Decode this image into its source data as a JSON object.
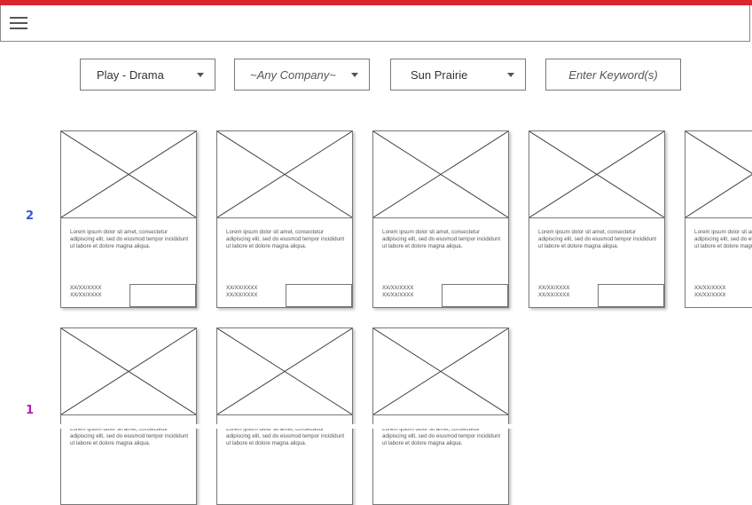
{
  "header": {
    "menu_icon": "hamburger-icon"
  },
  "filters": {
    "genre": "Play - Drama",
    "company": "~Any Company~",
    "location": "Sun Prairie",
    "keyword_placeholder": "Enter Keyword(s)"
  },
  "rows": [
    {
      "number": "2",
      "color": "#3357d6"
    },
    {
      "number": "1",
      "color": "#b31fb3"
    }
  ],
  "card_text": "Lorem ipsum dolor sit amet, consectetur adipiscing elit, sed do eiusmod tempor incididunt ut labore et dolore magna aliqua.",
  "card_date_1": "XX/XX/XXXX",
  "card_date_2": "XX/XX/XXXX",
  "colors": {
    "accent": "#d9262f"
  }
}
